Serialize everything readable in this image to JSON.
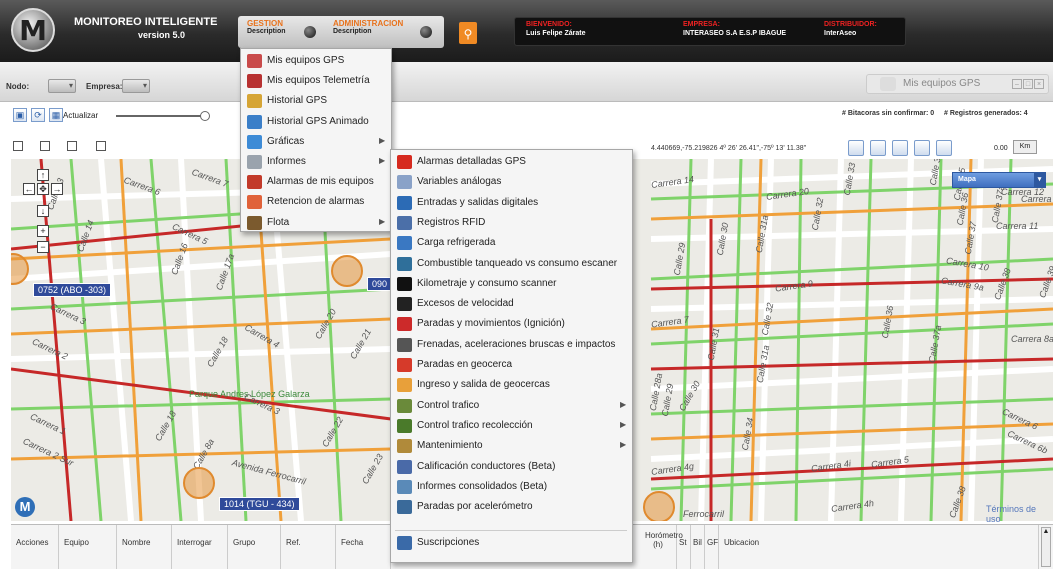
{
  "header": {
    "logo_letter": "M",
    "title": "MONITOREO INTELIGENTE",
    "version": "version 5.0",
    "nav": [
      {
        "title": "GESTION",
        "desc": "Description"
      },
      {
        "title": "ADMINISTRACION",
        "desc": "Description"
      }
    ],
    "info": [
      {
        "key": "BIENVENIDO:",
        "value": "Luis Felipe Zárate"
      },
      {
        "key": "EMPRESA:",
        "value": "INTERASEO S.A E.S.P IBAGUE"
      },
      {
        "key": "DISTRIBUIDOR:",
        "value": "InterAseo"
      }
    ]
  },
  "toolbar": {
    "nodo_label": "Nodo:",
    "empresa_label": "Empresa:",
    "actualizar_label": "Actualizar",
    "panel_title": "Mis equipos GPS",
    "bitacoras": "# Bitacoras sin confirmar: 0",
    "registros": "# Registros generados: 4",
    "coords": "4.440669,-75.219826  4º 26' 26.41\",-75º 13' 11.38\"",
    "scale": "0.00",
    "unit": "Km"
  },
  "map": {
    "type_label": "Mapa",
    "terminos": "Términos de uso",
    "vehicles": [
      "0752 (ABO -303)",
      "1014 (TGU - 434)",
      "090"
    ],
    "streets": [
      "Carrera 6",
      "Carrera 7",
      "Calle 14",
      "Calle 13",
      "Carrera 5",
      "Calle 16",
      "Calle 17a",
      "Carrera 3",
      "Carrera 2",
      "Carrera 1",
      "Calle 18",
      "Calle 20",
      "Calle 21",
      "Carrera 4",
      "Parque Andres López Galarza",
      "Calle 8a",
      "Calle 18",
      "Carrera 3",
      "Calle 22",
      "Calle 23",
      "Avenida Ferrocarril",
      "Carrera 2 Sur",
      "Carrera 14",
      "Carrera 20",
      "Calle 33",
      "Calle 35",
      "Calle 36",
      "Calle 37a",
      "Carrera 12",
      "Carrera 11",
      "Calle 32",
      "Calle 31a",
      "Calle 30",
      "Calle 29",
      "Carrera 10",
      "Carrera 9a",
      "Calle 38",
      "Calle 39",
      "Carrera 9",
      "Carrera 7",
      "Calle 32",
      "Calle 31",
      "Calle 31a",
      "Calle 36",
      "Calle 37a",
      "Carrera 8a",
      "Calle 28a",
      "Calle 29",
      "Calle 30",
      "Calle 34",
      "Carrera 6",
      "Carrera 6b",
      "Carrera 5",
      "Carrera 4g",
      "Carrera 4i",
      "Carrera 4h",
      "Calle 38",
      "Ferrocarril",
      "Calle 37",
      "Carrera 12",
      "Calle 35"
    ]
  },
  "gestion_menu": {
    "items": [
      {
        "label": "Mis equipos GPS",
        "icon": "gps-truck-icon",
        "color": "#c94b4b",
        "submenu": false
      },
      {
        "label": "Mis equipos Telemetría",
        "icon": "telemetry-icon",
        "color": "#b83232",
        "submenu": false
      },
      {
        "label": "Historial GPS",
        "icon": "history-icon",
        "color": "#d6a536",
        "submenu": false
      },
      {
        "label": "Historial GPS Animado",
        "icon": "animated-history-icon",
        "color": "#3b7fc8",
        "submenu": false
      },
      {
        "label": "Gráficas",
        "icon": "chart-icon",
        "color": "#3d8bd6",
        "submenu": true
      },
      {
        "label": "Informes",
        "icon": "report-icon",
        "color": "#9aa3ad",
        "submenu": true
      },
      {
        "label": "Alarmas de mis equipos",
        "icon": "alarm-icon",
        "color": "#c23a2a",
        "submenu": false
      },
      {
        "label": "Retencion de alarmas",
        "icon": "retention-icon",
        "color": "#e0623a",
        "submenu": false
      },
      {
        "label": "Flota",
        "icon": "fleet-icon",
        "color": "#7b5a2e",
        "submenu": true
      }
    ]
  },
  "informes_menu": {
    "items": [
      {
        "label": "Alarmas detalladas GPS",
        "icon": "alarm-light-icon",
        "color": "#d62a1f",
        "submenu": false
      },
      {
        "label": "Variables análogas",
        "icon": "analog-icon",
        "color": "#8aa2c8",
        "submenu": false
      },
      {
        "label": "Entradas y salidas digitales",
        "icon": "digital-io-icon",
        "color": "#2c6bb5",
        "submenu": false
      },
      {
        "label": "Registros RFID",
        "icon": "rfid-icon",
        "color": "#4b6fa8",
        "submenu": false
      },
      {
        "label": "Carga refrigerada",
        "icon": "refrigerated-truck-icon",
        "color": "#3a78c2",
        "submenu": false
      },
      {
        "label": "Combustible tanqueado vs consumo escaner",
        "icon": "fuel-tank-icon",
        "color": "#2f6f9a",
        "submenu": false
      },
      {
        "label": "Kilometraje y consumo scanner",
        "icon": "fuel-pump-icon",
        "color": "#111111",
        "submenu": false
      },
      {
        "label": "Excesos de velocidad",
        "icon": "speed-icon",
        "color": "#222222",
        "submenu": false
      },
      {
        "label": "Paradas y movimientos (Ignición)",
        "icon": "stop-sign-icon",
        "color": "#cc2a2a",
        "submenu": false
      },
      {
        "label": "Frenadas, aceleraciones bruscas e impactos",
        "icon": "brake-icon",
        "color": "#555555",
        "submenu": false
      },
      {
        "label": "Paradas en geocerca",
        "icon": "geofence-stop-icon",
        "color": "#d63a2a",
        "submenu": false
      },
      {
        "label": "Ingreso y salida de geocercas",
        "icon": "geofence-icon",
        "color": "#e8a03a",
        "submenu": false
      },
      {
        "label": "Control trafico",
        "icon": "traffic-icon",
        "color": "#6a8a3a",
        "submenu": true
      },
      {
        "label": "Control trafico recolección",
        "icon": "collection-traffic-icon",
        "color": "#4a7a2a",
        "submenu": true
      },
      {
        "label": "Mantenimiento",
        "icon": "maintenance-icon",
        "color": "#b08a3a",
        "submenu": true
      },
      {
        "label": "Calificación conductores (Beta)",
        "icon": "driver-rating-icon",
        "color": "#4a6aa8",
        "submenu": false
      },
      {
        "label": "Informes consolidados (Beta)",
        "icon": "consolidated-report-icon",
        "color": "#5a8ab8",
        "submenu": false
      },
      {
        "label": "Paradas por acelerómetro",
        "icon": "accelerometer-icon",
        "color": "#3a6a9a",
        "submenu": false
      },
      {
        "label": "Suscripciones",
        "icon": "subscription-icon",
        "color": "#3a6aa8",
        "submenu": false
      }
    ]
  },
  "grid": {
    "columns": [
      "Acciones",
      "Equipo",
      "Nombre",
      "Interrogar",
      "Grupo",
      "Ref.",
      "Fecha",
      "Horómetro (h)",
      "St",
      "Bil",
      "GF",
      "Ubicacion"
    ]
  }
}
